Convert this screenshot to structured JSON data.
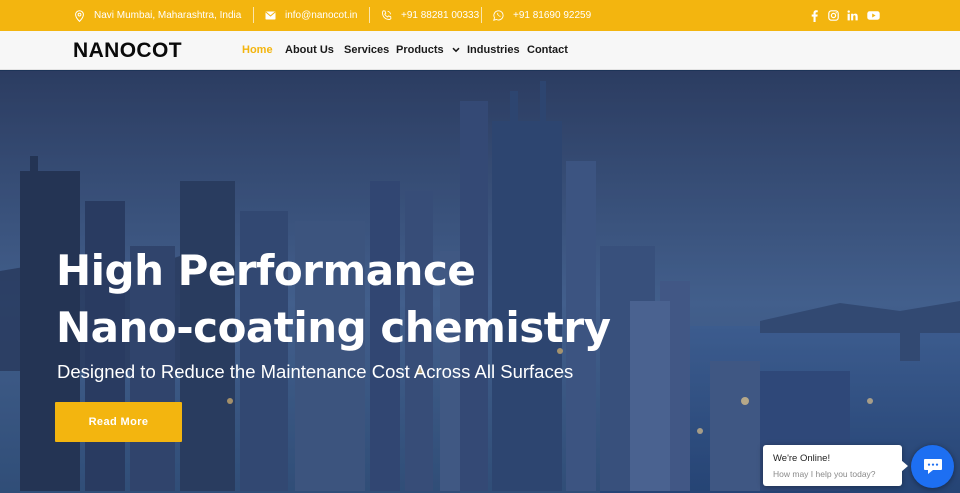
{
  "topbar": {
    "location": "Navi Mumbai, Maharashtra, India",
    "email": "info@nanocot.in",
    "phone": "+91 88281 00333",
    "whatsapp": "+91 81690 92259",
    "social_icons": [
      "facebook-icon",
      "instagram-icon",
      "linkedin-icon",
      "youtube-icon"
    ],
    "bg_color": "#f3b50f"
  },
  "navbar": {
    "logo": "NANOCOT",
    "items": [
      {
        "label": "Home",
        "active": true
      },
      {
        "label": "About Us"
      },
      {
        "label": "Services"
      },
      {
        "label": "Products",
        "has_dropdown": true
      },
      {
        "label": "Industries"
      },
      {
        "label": "Contact"
      }
    ],
    "active_color": "#f3b50f"
  },
  "hero": {
    "title_line1": "High Performance",
    "title_line2": "Nano-coating chemistry",
    "subtitle": "Designed to Reduce the Maintenance Cost Across All Surfaces",
    "cta_label": "Read More",
    "cta_color": "#f3b50f"
  },
  "chat": {
    "title": "We're Online!",
    "subtitle": "How may I help you today?",
    "button_color": "#1d6ff2"
  }
}
